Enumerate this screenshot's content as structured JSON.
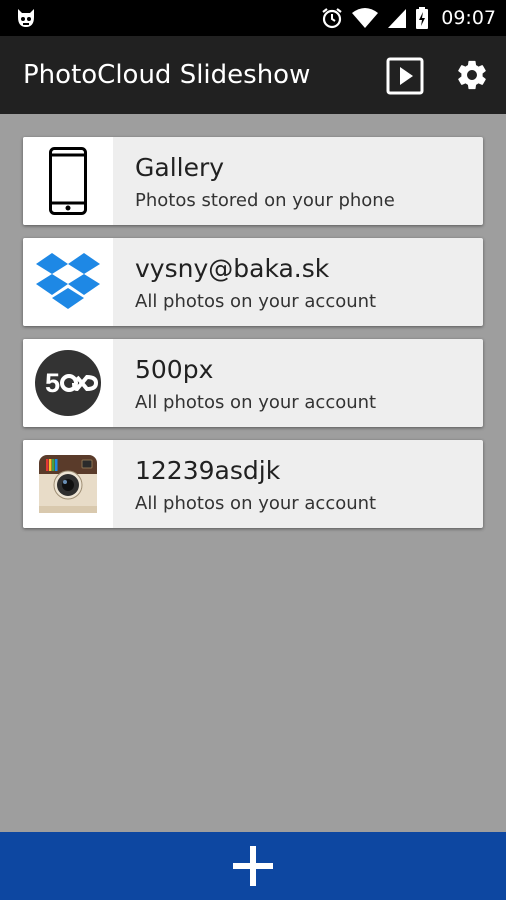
{
  "status_bar": {
    "time": "09:07"
  },
  "app_bar": {
    "title": "PhotoCloud Slideshow"
  },
  "sources": [
    {
      "title": "Gallery",
      "subtitle": "Photos stored on your phone",
      "icon": "phone-icon"
    },
    {
      "title": "vysny@baka.sk",
      "subtitle": "All photos on your account",
      "icon": "dropbox-icon"
    },
    {
      "title": "500px",
      "subtitle": "All photos on your account",
      "icon": "500px-icon",
      "icon_text": "5"
    },
    {
      "title": "12239asdjk",
      "subtitle": "All photos on your account",
      "icon": "instagram-icon"
    }
  ],
  "add_button": {
    "icon": "plus-icon"
  },
  "colors": {
    "status_bar": "#000000",
    "app_bar": "#212121",
    "background": "#9e9e9e",
    "card": "#eeeeee",
    "add_bar": "#0d47a1",
    "dropbox": "#1e88e5"
  }
}
